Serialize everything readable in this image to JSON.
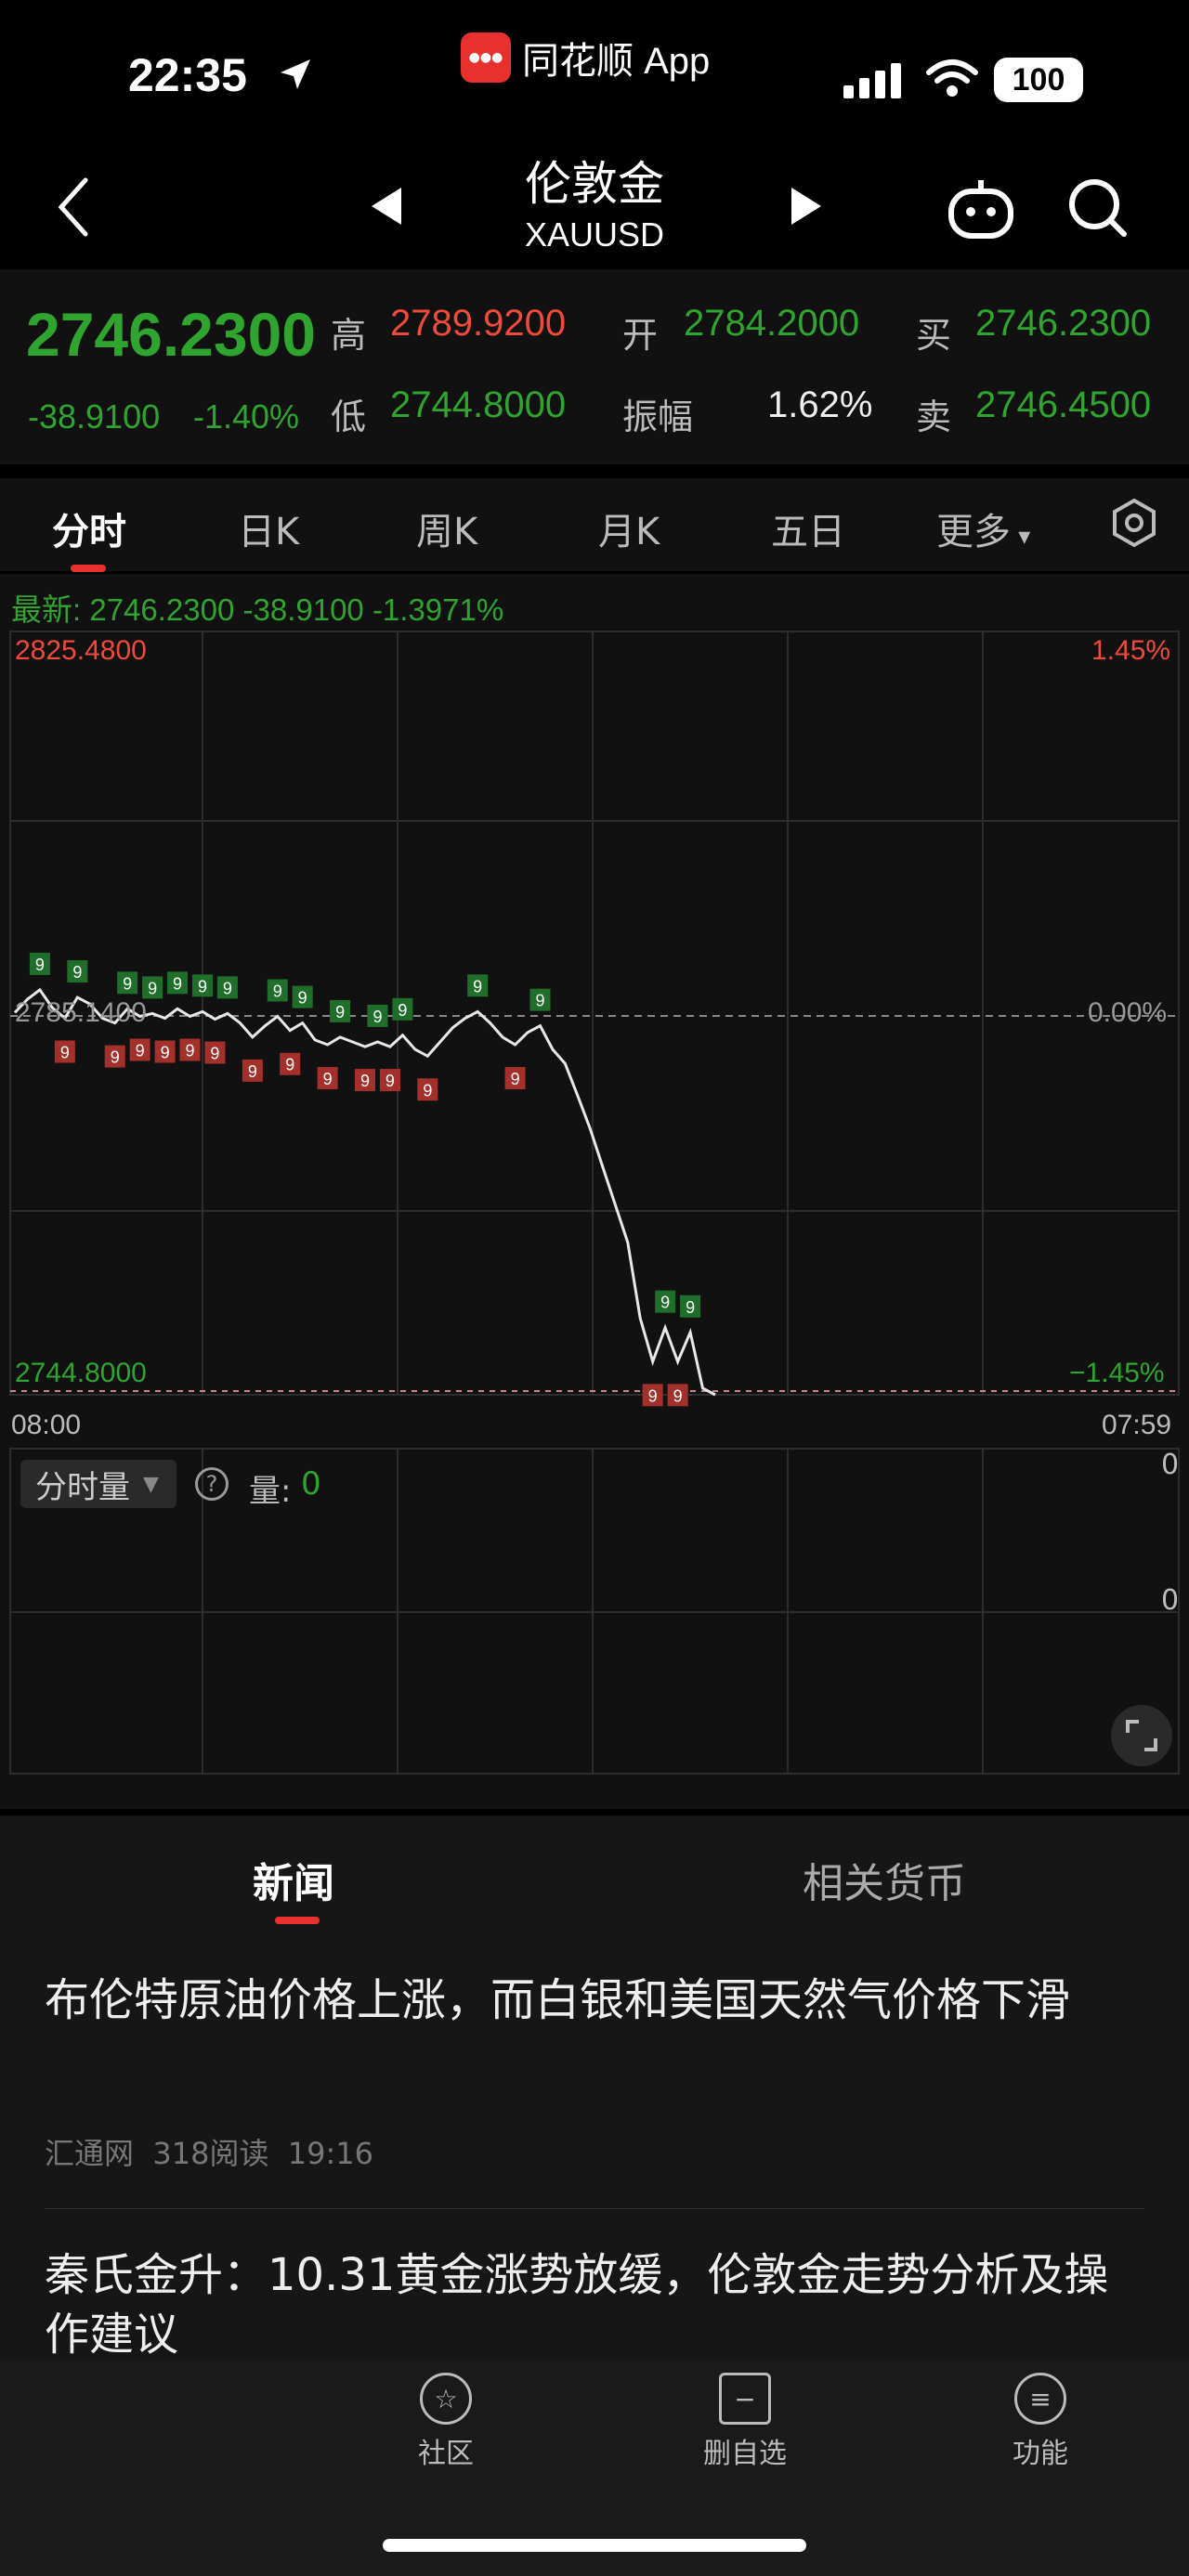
{
  "status_bar": {
    "time": "22:35",
    "app_name": "同花顺 App",
    "battery": "100"
  },
  "nav": {
    "title": "伦敦金",
    "subtitle": "XAUUSD"
  },
  "quote": {
    "price": "2746.2300",
    "change": "-38.9100",
    "change_pct": "-1.40%",
    "high_label": "高",
    "high": "2789.9200",
    "low_label": "低",
    "low": "2744.8000",
    "open_label": "开",
    "open": "2784.2000",
    "amp_label": "振幅",
    "amp": "1.62%",
    "buy_label": "买",
    "buy": "2746.2300",
    "sell_label": "卖",
    "sell": "2746.4500"
  },
  "tabs": [
    {
      "label": "分时",
      "active": true
    },
    {
      "label": "日K"
    },
    {
      "label": "周K"
    },
    {
      "label": "月K"
    },
    {
      "label": "五日"
    },
    {
      "label": "更多"
    }
  ],
  "latest": "最新: 2746.2300  -38.9100  -1.3971%",
  "chart": {
    "y_max": "2825.4800",
    "y_mid": "2785.1400",
    "y_min": "2744.8000",
    "pct_max": "1.45%",
    "pct_mid": "0.00%",
    "pct_min": "−1.45%",
    "x_start": "08:00",
    "x_end": "07:59"
  },
  "chart_data": {
    "type": "line",
    "series": [
      {
        "values": [
          2785.2,
          2786.6,
          2787.6,
          2785.7,
          2784.6,
          2786.8,
          2786.1,
          2784.6,
          2784.1,
          2785.6,
          2784.8,
          2785.1,
          2784.6,
          2785.6,
          2784.8,
          2785.3,
          2784.5,
          2785.1,
          2784.1,
          2782.6,
          2783.8,
          2784.8,
          2783.3,
          2784.1,
          2782.3,
          2781.8,
          2782.6,
          2782.1,
          2781.6,
          2782.1,
          2781.6,
          2782.8,
          2781.3,
          2780.6,
          2782.1,
          2783.6,
          2784.6,
          2785.3,
          2784.1,
          2782.6,
          2781.8,
          2783.1,
          2783.8,
          2781.3,
          2779.8,
          2776.4,
          2772.9,
          2768.9,
          2764.9,
          2760.9,
          2752.9,
          2748.3,
          2751.9,
          2748.3,
          2751.4,
          2745.5,
          2744.8
        ]
      }
    ],
    "ylim": [
      2744.8,
      2825.48
    ],
    "x_range": [
      "08:00",
      "07:59"
    ]
  },
  "volume": {
    "selector": "分时量",
    "label": "量:",
    "value": "0",
    "axis_top": "0",
    "axis_mid": "0"
  },
  "news": {
    "tab_news": "新闻",
    "tab_related": "相关货币",
    "items": [
      {
        "title": "布伦特原油价格上涨，而白银和美国天然气价格下滑",
        "source": "汇通网",
        "reads": "318阅读",
        "time": "19:16"
      },
      {
        "title": "秦氏金升：10.31黄金涨势放缓，伦敦金走势分析及操作建议"
      }
    ]
  },
  "bottom_nav": [
    {
      "label": "社区",
      "icon": "community-icon"
    },
    {
      "label": "删自选",
      "icon": "remove-watchlist-icon"
    },
    {
      "label": "功能",
      "icon": "menu-icon"
    }
  ]
}
